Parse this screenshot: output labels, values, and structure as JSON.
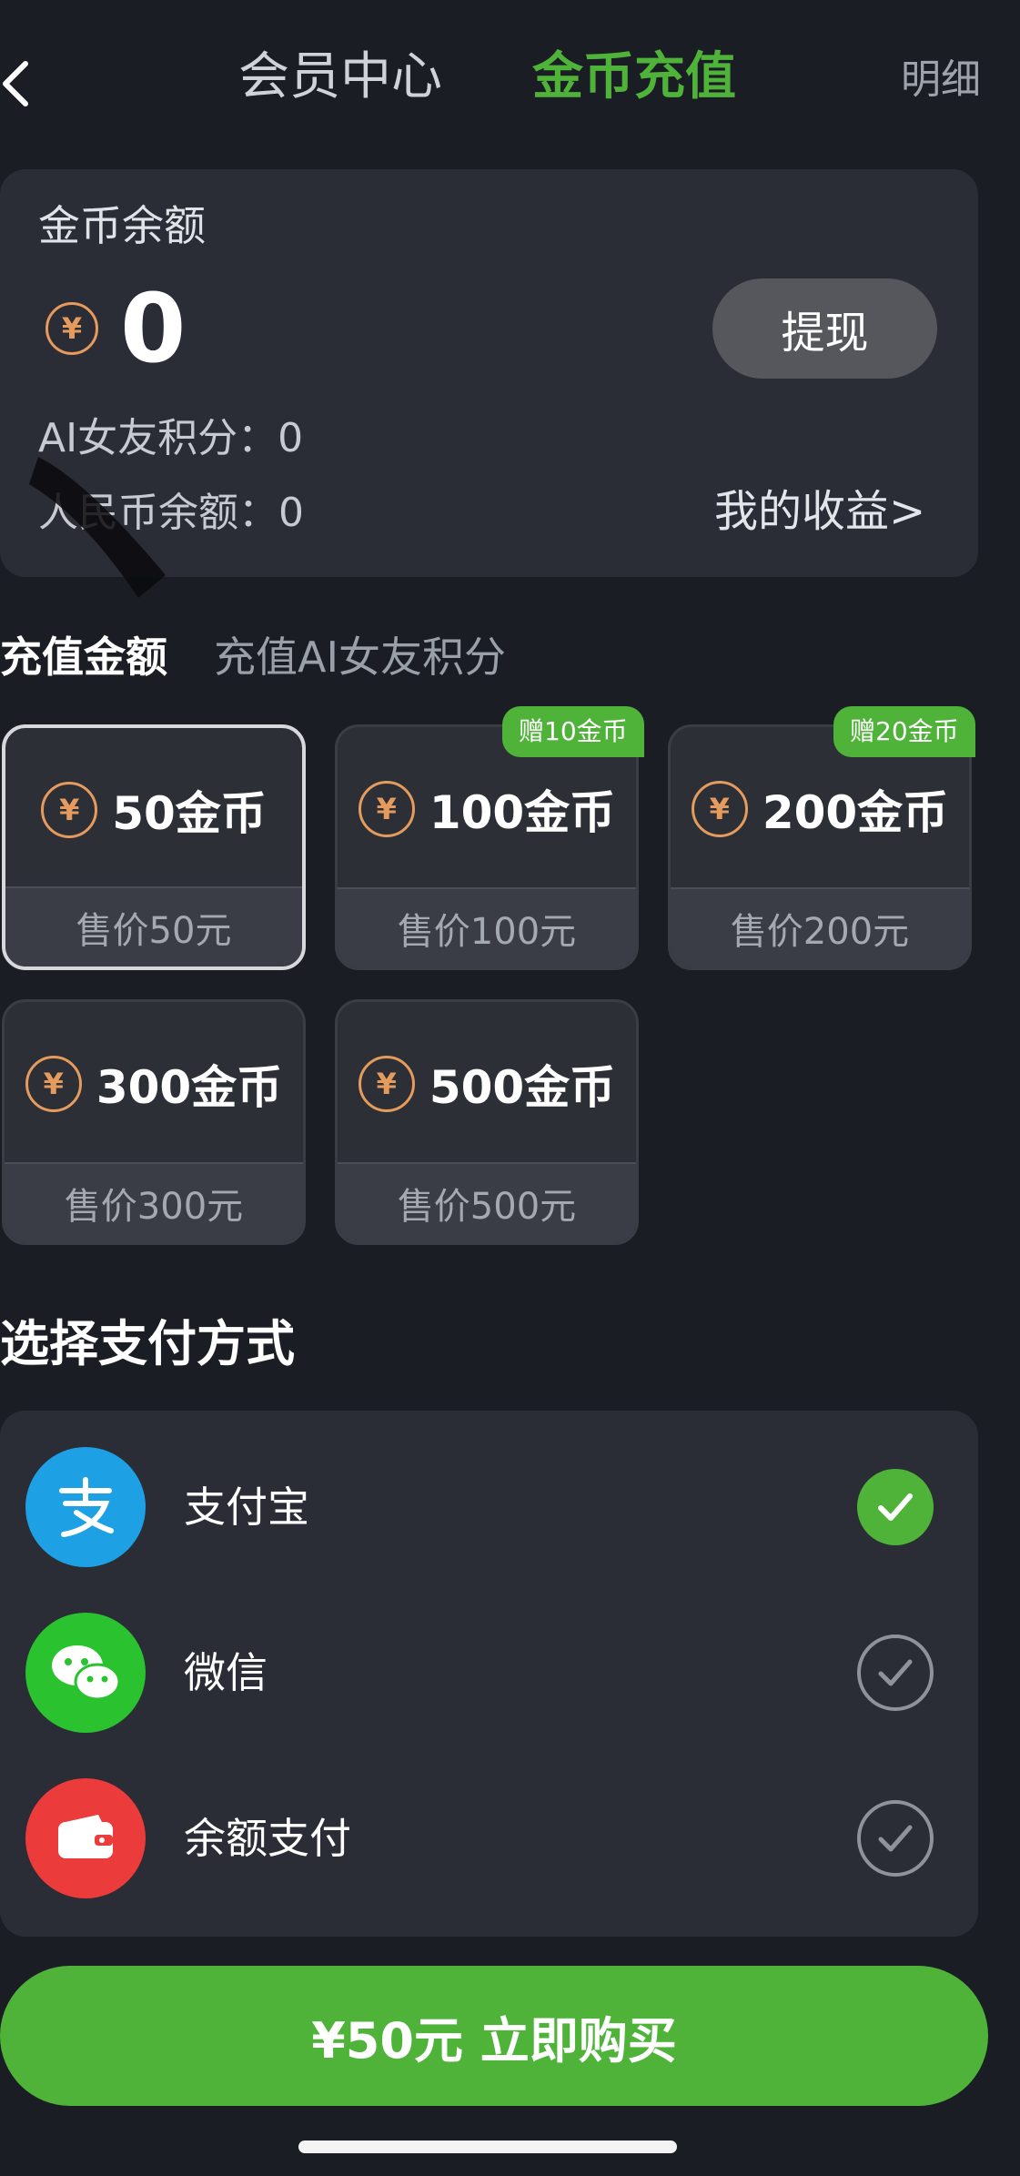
{
  "header": {
    "back_icon": "chevron-left-icon",
    "tab_vip": "会员中心",
    "tab_coin": "金币充值",
    "detail": "明细"
  },
  "balance_card": {
    "title": "金币余额",
    "coin_symbol": "¥",
    "balance": "0",
    "withdraw_label": "提现",
    "ai_points_line": "AI女友积分：0",
    "rmb_balance_line": "人民币余额：0",
    "earnings_link": "我的收益>"
  },
  "recharge_tabs": {
    "active": "充值金额",
    "inactive": "充值AI女友积分"
  },
  "packages": [
    {
      "amount": "50金币",
      "price": "售价50元",
      "badge": "",
      "selected": true
    },
    {
      "amount": "100金币",
      "price": "售价100元",
      "badge": "赠10金币",
      "selected": false
    },
    {
      "amount": "200金币",
      "price": "售价200元",
      "badge": "赠20金币",
      "selected": false
    },
    {
      "amount": "300金币",
      "price": "售价300元",
      "badge": "",
      "selected": false
    },
    {
      "amount": "500金币",
      "price": "售价500元",
      "badge": "",
      "selected": false
    }
  ],
  "payment": {
    "title": "选择支付方式",
    "methods": [
      {
        "label": "支付宝",
        "icon": "alipay-icon",
        "selected": true,
        "color": "#1ea0e4"
      },
      {
        "label": "微信",
        "icon": "wechat-icon",
        "selected": false,
        "color": "#2ac22e"
      },
      {
        "label": "余额支付",
        "icon": "wallet-icon",
        "selected": false,
        "color": "#ec3b3b"
      }
    ]
  },
  "buy_button": {
    "label": "¥50元 立即购买"
  },
  "colors": {
    "accent": "#4fb33a",
    "coin": "#e59a5e",
    "background": "#1a1d23",
    "card": "#2a2d35"
  }
}
